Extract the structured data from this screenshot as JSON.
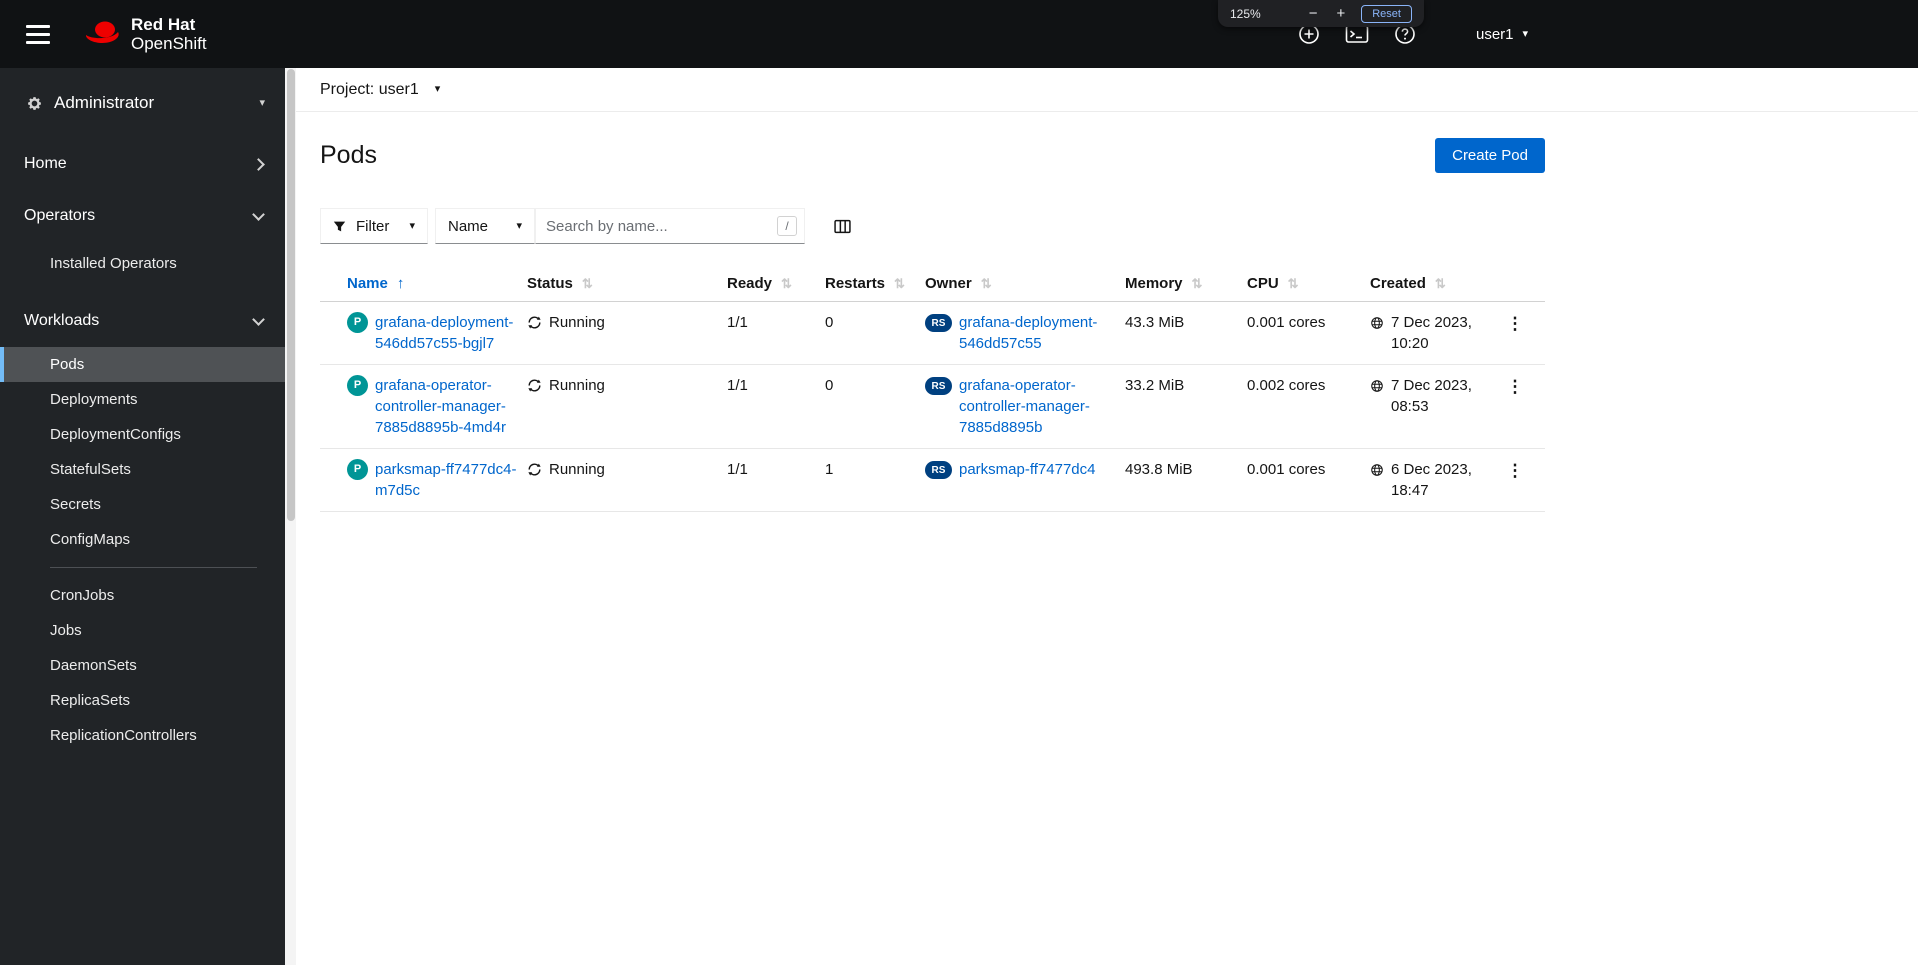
{
  "masthead": {
    "brand_line1": "Red Hat",
    "brand_line2": "OpenShift",
    "username": "user1"
  },
  "zoom_popup": {
    "level": "125%",
    "minus_label": "−",
    "plus_label": "+",
    "reset_label": "Reset"
  },
  "icons": {
    "caret_down": "▾",
    "kebab": "⋮",
    "sort_inactive": "⇅",
    "sort_asc": "↑"
  },
  "sidebar": {
    "perspective": "Administrator",
    "items_top": [
      "Home",
      "Operators",
      "Workloads"
    ],
    "operators_children": [
      "Installed Operators"
    ],
    "workloads_children": [
      "Pods",
      "Deployments",
      "DeploymentConfigs",
      "StatefulSets",
      "Secrets",
      "ConfigMaps",
      "CronJobs",
      "Jobs",
      "DaemonSets",
      "ReplicaSets",
      "ReplicationControllers"
    ],
    "active_item": "Pods"
  },
  "project_bar": {
    "label": "Project:",
    "value": "user1"
  },
  "page": {
    "title": "Pods",
    "create_button": "Create Pod"
  },
  "toolbar": {
    "filter_label": "Filter",
    "attribute_label": "Name",
    "search_placeholder": "Search by name...",
    "search_shortcut": "/"
  },
  "table": {
    "columns": [
      "Name",
      "Status",
      "Ready",
      "Restarts",
      "Owner",
      "Memory",
      "CPU",
      "Created"
    ],
    "rows": [
      {
        "kind_badge": "P",
        "name": "grafana-deployment-546dd57c55-bgjl7",
        "status": "Running",
        "ready": "1/1",
        "restarts": "0",
        "owner_kind_badge": "RS",
        "owner": "grafana-deployment-546dd57c55",
        "memory": "43.3 MiB",
        "cpu": "0.001 cores",
        "created": "7 Dec 2023, 10:20"
      },
      {
        "kind_badge": "P",
        "name": "grafana-operator-controller-manager-7885d8895b-4md4r",
        "status": "Running",
        "ready": "1/1",
        "restarts": "0",
        "owner_kind_badge": "RS",
        "owner": "grafana-operator-controller-manager-7885d8895b",
        "memory": "33.2 MiB",
        "cpu": "0.002 cores",
        "created": "7 Dec 2023, 08:53"
      },
      {
        "kind_badge": "P",
        "name": "parksmap-ff7477dc4-m7d5c",
        "status": "Running",
        "ready": "1/1",
        "restarts": "1",
        "owner_kind_badge": "RS",
        "owner": "parksmap-ff7477dc4",
        "memory": "493.8 MiB",
        "cpu": "0.001 cores",
        "created": "6 Dec 2023, 18:47"
      }
    ]
  }
}
